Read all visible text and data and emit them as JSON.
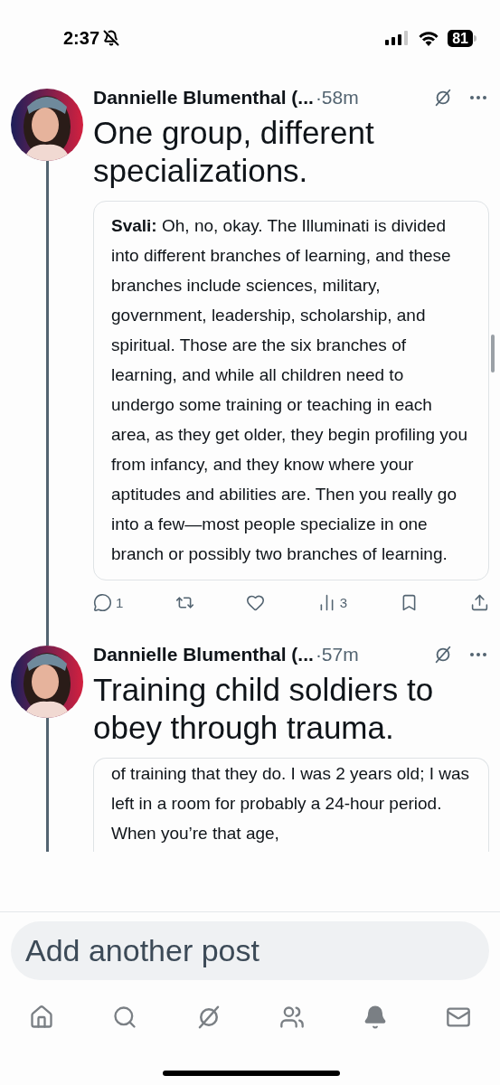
{
  "status_bar": {
    "time": "2:37",
    "battery": "81"
  },
  "posts": [
    {
      "author": "Dannielle Blumenthal (...",
      "time": "·58m",
      "title": "One group, different specializations.",
      "quote": "**Svali:** Oh, no, okay. The Illuminati is divided into different branches of learning, and these branches include sciences, military, government, leadership, scholarship, and spiritual. Those are the six branches of learning, and while all children need to undergo some training or teaching in each area, as they get older, they begin profiling you from infancy, and they know where your aptitudes and abilities are. Then you really go into a few—most people specialize in one branch or possibly two branches of learning.",
      "actions": [
        {
          "kind": "reply",
          "count": "1"
        },
        {
          "kind": "repost"
        },
        {
          "kind": "like"
        },
        {
          "kind": "views",
          "count": "3"
        },
        {
          "kind": "bookmark"
        },
        {
          "kind": "share"
        }
      ]
    },
    {
      "author": "Dannielle Blumenthal (...",
      "time": "·57m",
      "title": "Training child soldiers to obey through trauma.",
      "quote": "of training that they do. I was 2 years old; I was left in a room for probably a 24-hour period. When you’re that age,"
    }
  ],
  "composer": {
    "placeholder": "Add another post"
  },
  "nav": [
    {
      "kind": "home"
    },
    {
      "kind": "search"
    },
    {
      "kind": "grok"
    },
    {
      "kind": "communities"
    },
    {
      "kind": "notifications"
    },
    {
      "kind": "messages"
    }
  ]
}
